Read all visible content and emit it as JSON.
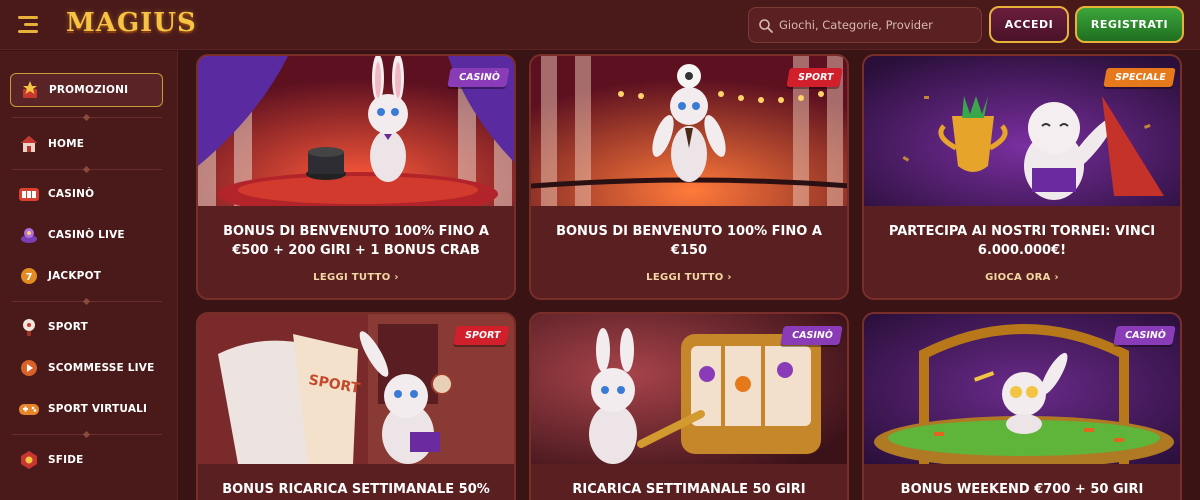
{
  "header": {
    "logo": "MAGIUS",
    "search_placeholder": "Giochi, Categorie, Provider",
    "login_label": "ACCEDI",
    "register_label": "REGISTRATI"
  },
  "sidebar": {
    "items": [
      {
        "label": "PROMOZIONI",
        "icon": "promotions-star-icon"
      },
      {
        "label": "HOME",
        "icon": "home-icon"
      },
      {
        "label": "CASINÒ",
        "icon": "casino-slot-icon"
      },
      {
        "label": "CASINÒ LIVE",
        "icon": "live-casino-icon"
      },
      {
        "label": "JACKPOT",
        "icon": "jackpot-icon"
      },
      {
        "label": "SPORT",
        "icon": "sport-ball-icon"
      },
      {
        "label": "SCOMMESSE LIVE",
        "icon": "live-bets-icon"
      },
      {
        "label": "SPORT VIRTUALI",
        "icon": "gamepad-icon"
      },
      {
        "label": "SFIDE",
        "icon": "challenges-icon"
      }
    ]
  },
  "cards": [
    {
      "tag": "CASINÒ",
      "title": "BONUS DI BENVENUTO 100% FINO A €500 + 200 GIRI + 1 BONUS CRAB",
      "link": "LEGGI TUTTO"
    },
    {
      "tag": "SPORT",
      "title": "BONUS DI BENVENUTO 100% FINO A €150",
      "link": "LEGGI TUTTO"
    },
    {
      "tag": "SPECIALE",
      "title": "PARTECIPA AI NOSTRI TORNEI: VINCI 6.000.000€!",
      "link": "GIOCA ORA"
    },
    {
      "tag": "SPORT",
      "title": "BONUS RICARICA SETTIMANALE 50%",
      "link": ""
    },
    {
      "tag": "CASINÒ",
      "title": "RICARICA SETTIMANALE 50 GIRI",
      "link": ""
    },
    {
      "tag": "CASINÒ",
      "title": "BONUS WEEKEND €700 + 50 GIRI",
      "link": ""
    }
  ],
  "colors": {
    "background": "#3a1415",
    "panel": "#4a1a1a",
    "gold": "#e8b23a",
    "register_green": "#2f8f2e",
    "tag_casino": "#8a3bb8",
    "tag_sport": "#d11f2b",
    "tag_speciale": "#e6791b"
  }
}
